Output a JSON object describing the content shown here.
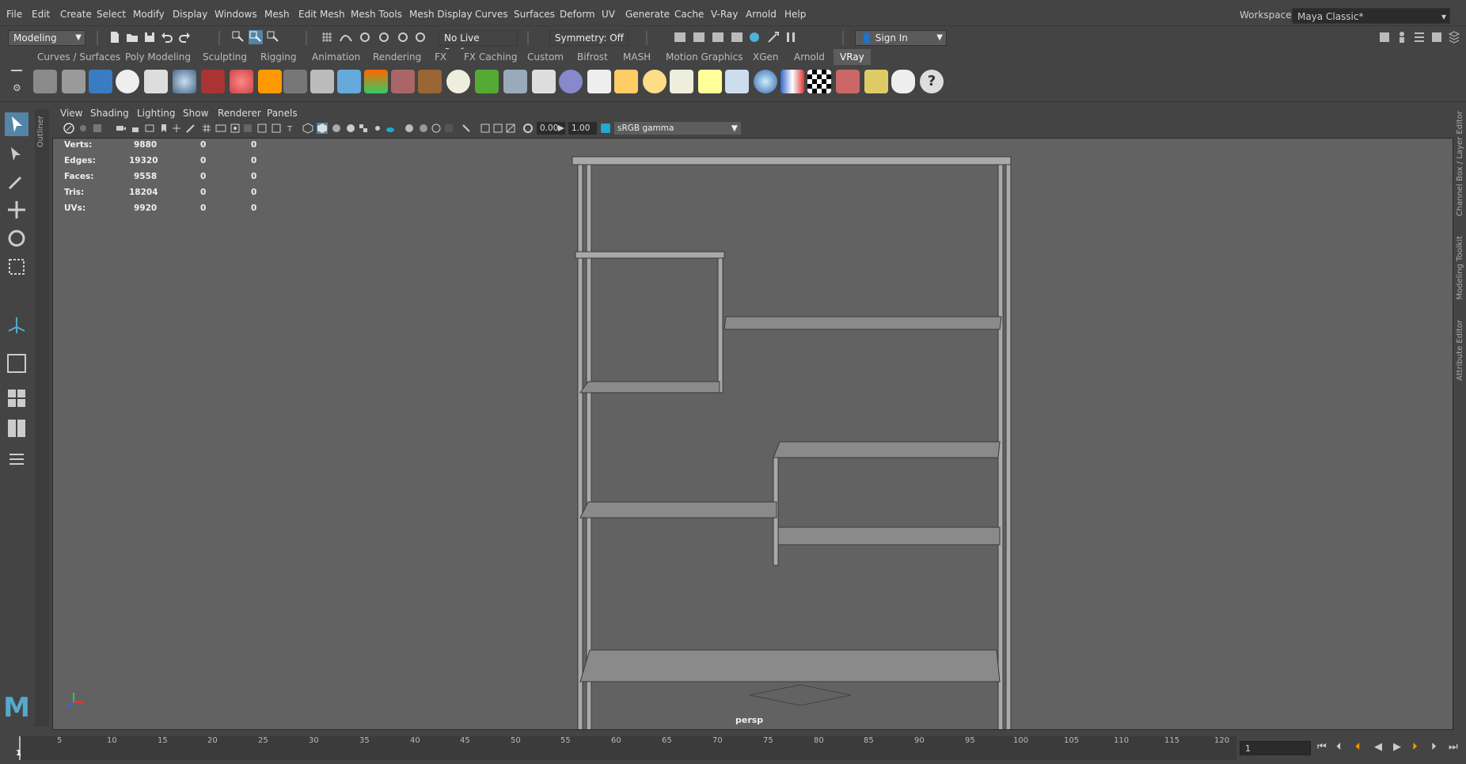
{
  "menubar": {
    "items": [
      "File",
      "Edit",
      "Create",
      "Select",
      "Modify",
      "Display",
      "Windows",
      "Mesh",
      "Edit Mesh",
      "Mesh Tools",
      "Mesh Display",
      "Curves",
      "Surfaces",
      "Deform",
      "UV",
      "Generate",
      "Cache",
      "V-Ray",
      "Arnold",
      "Help"
    ],
    "workspace_label": "Workspace :",
    "workspace_value": "Maya Classic*"
  },
  "statusline": {
    "mode": "Modeling",
    "live_surface": "No Live Surface",
    "symmetry": "Symmetry: Off",
    "sign_in": "Sign In"
  },
  "shelf": {
    "tabs": [
      "Curves / Surfaces",
      "Poly Modeling",
      "Sculpting",
      "Rigging",
      "Animation",
      "Rendering",
      "FX",
      "FX Caching",
      "Custom",
      "Bifrost",
      "MASH",
      "Motion Graphics",
      "XGen",
      "Arnold",
      "VRay"
    ],
    "active_tab": "VRay"
  },
  "outliner": {
    "label": "Outliner"
  },
  "viewport": {
    "menu": [
      "View",
      "Shading",
      "Lighting",
      "Show",
      "Renderer",
      "Panels"
    ],
    "exposure": "0.00",
    "gamma": "1.00",
    "color_space": "sRGB gamma",
    "camera": "persp",
    "hud": [
      {
        "label": "Verts:",
        "v1": "9880",
        "v2": "0",
        "v3": "0"
      },
      {
        "label": "Edges:",
        "v1": "19320",
        "v2": "0",
        "v3": "0"
      },
      {
        "label": "Faces:",
        "v1": "9558",
        "v2": "0",
        "v3": "0"
      },
      {
        "label": "Tris:",
        "v1": "18204",
        "v2": "0",
        "v3": "0"
      },
      {
        "label": "UVs:",
        "v1": "9920",
        "v2": "0",
        "v3": "0"
      }
    ]
  },
  "right_panels": [
    "Channel Box / Layer Editor",
    "Modeling Toolkit",
    "Attribute Editor"
  ],
  "timeline": {
    "ticks": [
      "1",
      "5",
      "10",
      "15",
      "20",
      "25",
      "30",
      "35",
      "40",
      "45",
      "50",
      "55",
      "60",
      "65",
      "70",
      "75",
      "80",
      "85",
      "90",
      "95",
      "100",
      "105",
      "110",
      "115",
      "120"
    ],
    "current_frame": "1"
  },
  "colors": {
    "bg": "#444444",
    "viewport": "#626262",
    "accent": "#5285a6"
  }
}
